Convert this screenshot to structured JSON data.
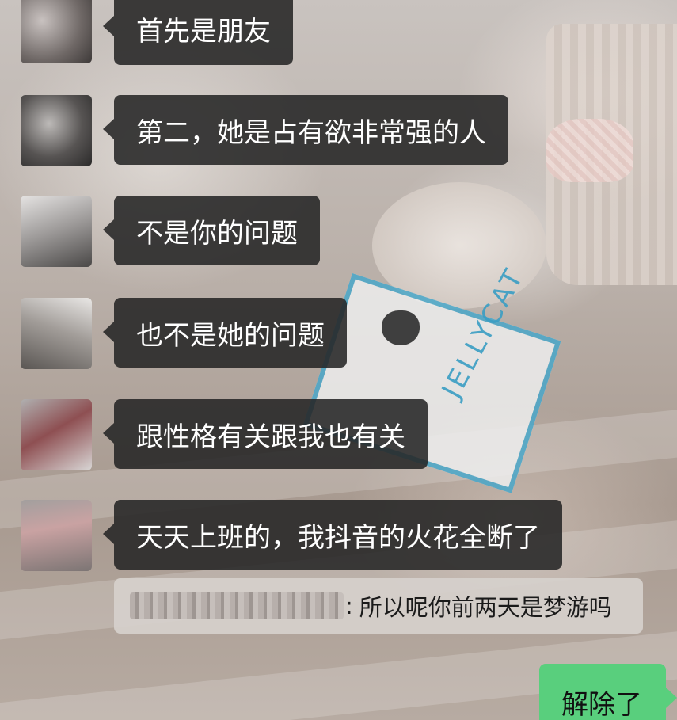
{
  "chat": {
    "messages": [
      {
        "text": "首先是朋友",
        "avatar_tint": "#7a6f6d"
      },
      {
        "text": "第二，她是占有欲非常强的人",
        "avatar_tint": "#6d6b6a"
      },
      {
        "text": "不是你的问题",
        "avatar_tint": "#8a8786"
      },
      {
        "text": "也不是她的问题",
        "avatar_tint": "#85807c"
      },
      {
        "text": "跟性格有关跟我也有关",
        "avatar_tint": "#8d5a5a"
      },
      {
        "text": "天天上班的，我抖音的火花全断了",
        "avatar_tint": "#9a7f7d"
      }
    ],
    "quote": {
      "colon": ":",
      "text": "所以呢你前两天是梦游吗"
    },
    "self_message": {
      "text": "解除了",
      "color": "#59cf7d"
    }
  }
}
